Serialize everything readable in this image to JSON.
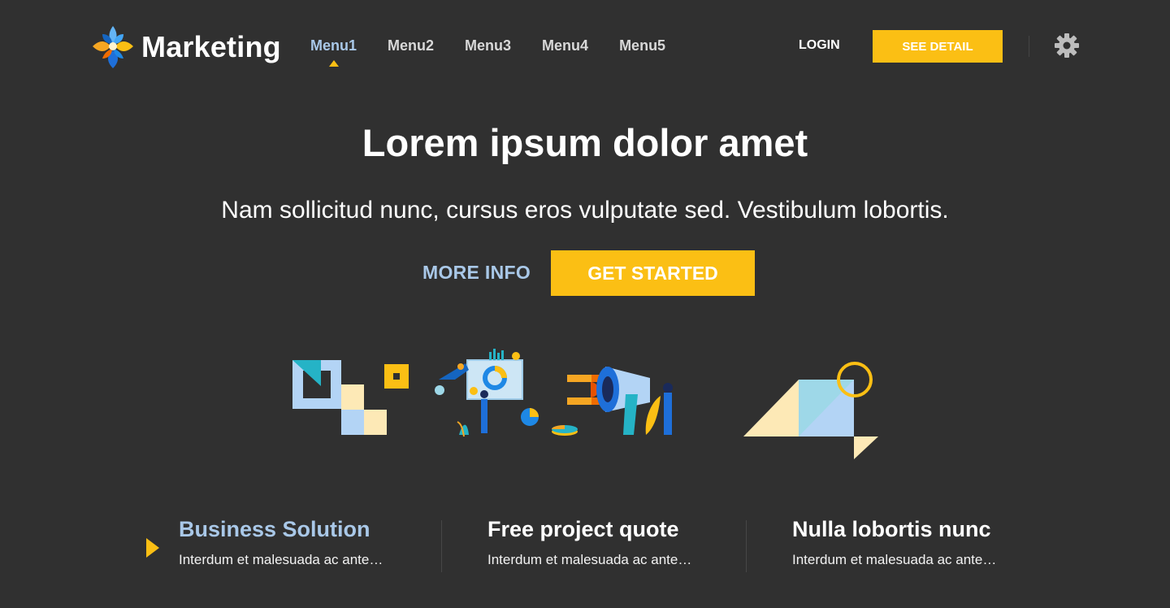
{
  "header": {
    "brand": "Marketing",
    "logo_icon": "flower-logo-icon",
    "menu": [
      {
        "label": "Menu1",
        "active": true
      },
      {
        "label": "Menu2",
        "active": false
      },
      {
        "label": "Menu3",
        "active": false
      },
      {
        "label": "Menu4",
        "active": false
      },
      {
        "label": "Menu5",
        "active": false
      }
    ],
    "login_label": "LOGIN",
    "see_detail_label": "SEE DETAIL",
    "settings_icon": "gear-icon"
  },
  "hero": {
    "title": "Lorem ipsum dolor amet",
    "subtitle": "Nam sollicitud nunc, cursus eros vulputate sed. Vestibulum lobortis.",
    "more_info_label": "MORE INFO",
    "get_started_label": "GET STARTED"
  },
  "features": [
    {
      "title": "Business Solution",
      "desc": "Interdum et malesuada ac ante…",
      "active": true
    },
    {
      "title": "Free project quote",
      "desc": "Interdum et malesuada ac ante…",
      "active": false
    },
    {
      "title": "Nulla lobortis nunc",
      "desc": "Interdum et malesuada ac ante…",
      "active": false
    }
  ],
  "colors": {
    "background": "#303030",
    "accent": "#fbbf14",
    "link": "#a9c8e8"
  }
}
